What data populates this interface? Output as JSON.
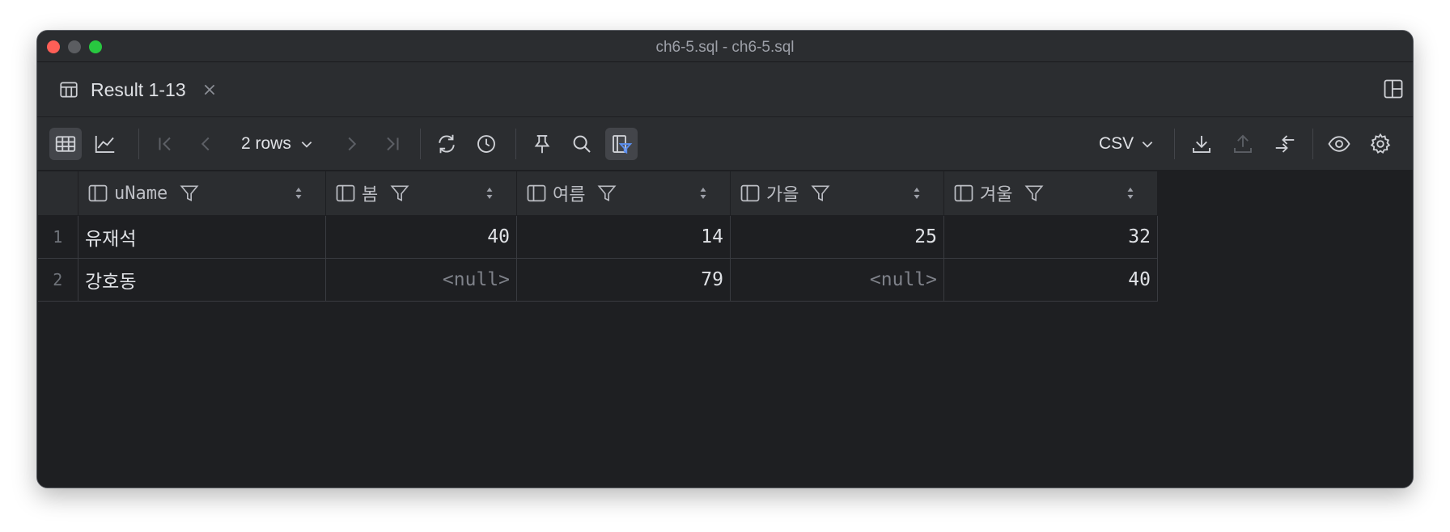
{
  "window": {
    "title": "ch6-5.sql - ch6-5.sql"
  },
  "tab": {
    "label": "Result 1-13"
  },
  "toolbar": {
    "rows_label": "2 rows",
    "format_label": "CSV"
  },
  "table": {
    "columns": [
      "uName",
      "봄",
      "여름",
      "가을",
      "겨울"
    ],
    "rows": [
      {
        "num": "1",
        "cells": [
          "유재석",
          "40",
          "14",
          "25",
          "32"
        ]
      },
      {
        "num": "2",
        "cells": [
          "강호동",
          "<null>",
          "79",
          "<null>",
          "40"
        ]
      }
    ]
  },
  "colors": {
    "accent_filter": "#5a8ef0",
    "null_text": "#7e8189"
  }
}
